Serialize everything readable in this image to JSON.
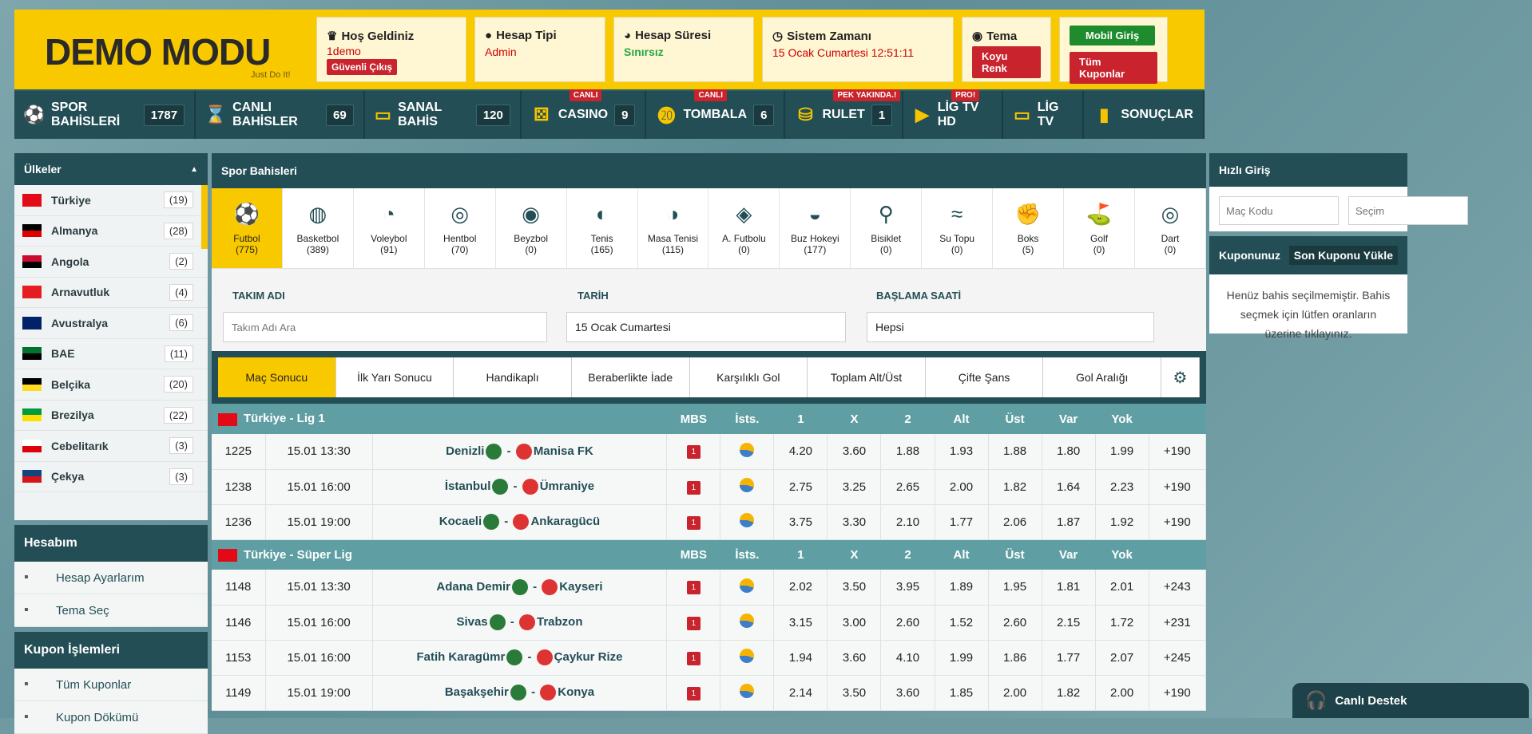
{
  "header": {
    "logo": "DEMO MODU",
    "slogan": "Just Do It!",
    "welcome_title": "Hoş Geldiniz",
    "welcome_user": "1demo",
    "logout": "Güvenli Çıkış",
    "account_type_title": "Hesap Tipi",
    "account_type": "Admin",
    "account_duration_title": "Hesap Süresi",
    "account_duration": "Sınırsız",
    "system_time_title": "Sistem Zamanı",
    "system_time": "15 Ocak Cumartesi 12:51:11",
    "theme_title": "Tema",
    "theme_button": "Koyu Renk",
    "mobile_login": "Mobil Giriş",
    "all_coupons": "Tüm Kuponlar"
  },
  "nav": [
    {
      "label": "SPOR BAHİSLERİ",
      "count": "1787",
      "icon": "soccer-ball-icon",
      "badge": ""
    },
    {
      "label": "CANLI BAHİSLER",
      "count": "69",
      "icon": "hourglass-icon",
      "badge": ""
    },
    {
      "label": "SANAL BAHİS",
      "count": "120",
      "icon": "vr-headset-icon",
      "badge": ""
    },
    {
      "label": "CASINO",
      "count": "9",
      "icon": "dice-icon",
      "badge": "CANLI"
    },
    {
      "label": "TOMBALA",
      "count": "6",
      "icon": "tombala-icon",
      "badge": "CANLI"
    },
    {
      "label": "RULET",
      "count": "1",
      "icon": "coins-icon",
      "badge": "PEK YAKINDA.!"
    },
    {
      "label": "LİG TV HD",
      "count": "",
      "icon": "youtube-icon",
      "badge": "PRO!"
    },
    {
      "label": "LİG TV",
      "count": "",
      "icon": "monitor-icon",
      "badge": ""
    },
    {
      "label": "SONUÇLAR",
      "count": "",
      "icon": "bar-chart-icon",
      "badge": ""
    }
  ],
  "left": {
    "countries_title": "Ülkeler",
    "countries": [
      {
        "name": "Türkiye",
        "count": "(19)"
      },
      {
        "name": "Almanya",
        "count": "(28)"
      },
      {
        "name": "Angola",
        "count": "(2)"
      },
      {
        "name": "Arnavutluk",
        "count": "(4)"
      },
      {
        "name": "Avustralya",
        "count": "(6)"
      },
      {
        "name": "BAE",
        "count": "(11)"
      },
      {
        "name": "Belçika",
        "count": "(20)"
      },
      {
        "name": "Brezilya",
        "count": "(22)"
      },
      {
        "name": "Cebelitarık",
        "count": "(3)"
      },
      {
        "name": "Çekya",
        "count": "(3)"
      }
    ],
    "account_title": "Hesabım",
    "account_items": [
      "Hesap Ayarlarım",
      "Tema Seç"
    ],
    "coupon_title": "Kupon İşlemleri",
    "coupon_items": [
      "Tüm Kuponlar",
      "Kupon Dökümü"
    ]
  },
  "center": {
    "title": "Spor Bahisleri",
    "sports": [
      {
        "name": "Futbol",
        "count": "(775)"
      },
      {
        "name": "Basketbol",
        "count": "(389)"
      },
      {
        "name": "Voleybol",
        "count": "(91)"
      },
      {
        "name": "Hentbol",
        "count": "(70)"
      },
      {
        "name": "Beyzbol",
        "count": "(0)"
      },
      {
        "name": "Tenis",
        "count": "(165)"
      },
      {
        "name": "Masa Tenisi",
        "count": "(115)"
      },
      {
        "name": "A. Futbolu",
        "count": "(0)"
      },
      {
        "name": "Buz Hokeyi",
        "count": "(177)"
      },
      {
        "name": "Bisiklet",
        "count": "(0)"
      },
      {
        "name": "Su Topu",
        "count": "(0)"
      },
      {
        "name": "Boks",
        "count": "(5)"
      },
      {
        "name": "Golf",
        "count": "(0)"
      },
      {
        "name": "Dart",
        "count": "(0)"
      }
    ],
    "filter_team_label": "TAKIM ADI",
    "filter_team_placeholder": "Takım Adı Ara",
    "filter_date_label": "TARİH",
    "filter_date_value": "15 Ocak Cumartesi",
    "filter_time_label": "BAŞLAMA SAATİ",
    "filter_time_value": "Hepsi",
    "tabs": [
      "Maç Sonucu",
      "İlk Yarı Sonucu",
      "Handikaplı",
      "Beraberlikte İade",
      "Karşılıklı Gol",
      "Toplam Alt/Üst",
      "Çifte Şans",
      "Gol Aralığı"
    ],
    "columns": [
      "MBS",
      "İsts.",
      "1",
      "X",
      "2",
      "Alt",
      "Üst",
      "Var",
      "Yok"
    ],
    "leagues": [
      {
        "name": "Türkiye - Lig 1",
        "matches": [
          {
            "code": "1225",
            "time": "15.01 13:30",
            "home": "Denizli",
            "away": "Manisa FK",
            "mbs": "1",
            "o": [
              "4.20",
              "3.60",
              "1.88",
              "1.93",
              "1.88",
              "1.80",
              "1.99"
            ],
            "more": "+190"
          },
          {
            "code": "1238",
            "time": "15.01 16:00",
            "home": "İstanbul",
            "away": "Ümraniye",
            "mbs": "1",
            "o": [
              "2.75",
              "3.25",
              "2.65",
              "2.00",
              "1.82",
              "1.64",
              "2.23"
            ],
            "more": "+190"
          },
          {
            "code": "1236",
            "time": "15.01 19:00",
            "home": "Kocaeli",
            "away": "Ankaragücü",
            "mbs": "1",
            "o": [
              "3.75",
              "3.30",
              "2.10",
              "1.77",
              "2.06",
              "1.87",
              "1.92"
            ],
            "more": "+190"
          }
        ]
      },
      {
        "name": "Türkiye - Süper Lig",
        "matches": [
          {
            "code": "1148",
            "time": "15.01 13:30",
            "home": "Adana Demir",
            "away": "Kayseri",
            "mbs": "1",
            "o": [
              "2.02",
              "3.50",
              "3.95",
              "1.89",
              "1.95",
              "1.81",
              "2.01"
            ],
            "more": "+243"
          },
          {
            "code": "1146",
            "time": "15.01 16:00",
            "home": "Sivas",
            "away": "Trabzon",
            "mbs": "1",
            "o": [
              "3.15",
              "3.00",
              "2.60",
              "1.52",
              "2.60",
              "2.15",
              "1.72"
            ],
            "more": "+231"
          },
          {
            "code": "1153",
            "time": "15.01 16:00",
            "home": "Fatih Karagümr",
            "away": "Çaykur Rize",
            "mbs": "1",
            "o": [
              "1.94",
              "3.60",
              "4.10",
              "1.99",
              "1.86",
              "1.77",
              "2.07"
            ],
            "more": "+245"
          },
          {
            "code": "1149",
            "time": "15.01 19:00",
            "home": "Başakşehir",
            "away": "Konya",
            "mbs": "1",
            "o": [
              "2.14",
              "3.50",
              "3.60",
              "1.85",
              "2.00",
              "1.82",
              "2.00"
            ],
            "more": "+190"
          }
        ]
      }
    ]
  },
  "right": {
    "quick_title": "Hızlı Giriş",
    "code_placeholder": "Maç Kodu",
    "choice_placeholder": "Seçim",
    "coupon_title": "Kuponunuz",
    "load_last": "Son Kuponu Yükle",
    "empty_msg": "Henüz bahis seçilmemiştir. Bahis seçmek için lütfen oranların üzerine tıklayınız."
  },
  "support": "Canlı Destek",
  "colors": {
    "accent": "#f9c900",
    "primary": "#234e55",
    "danger": "#c9232d"
  }
}
